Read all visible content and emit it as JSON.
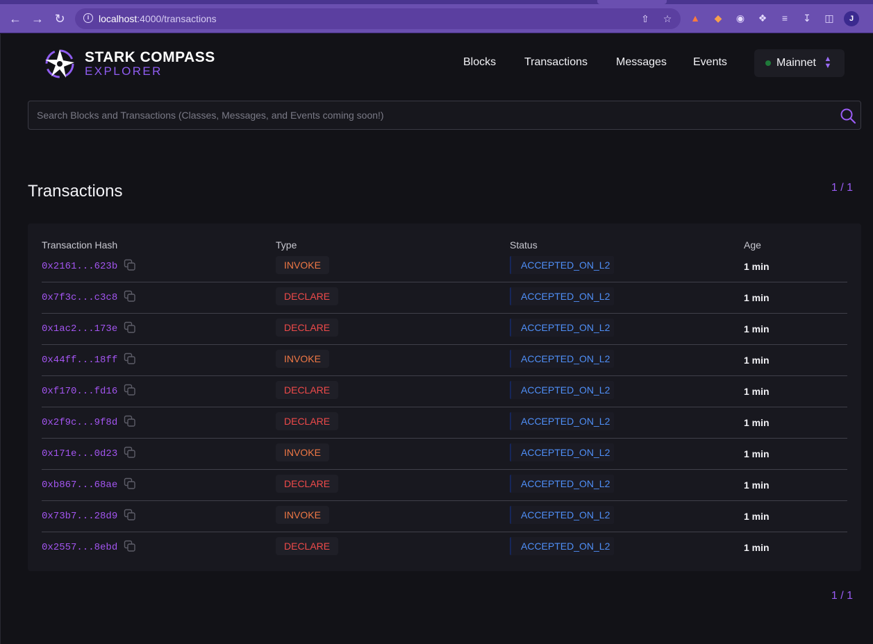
{
  "browser": {
    "url_host": "localhost",
    "url_path": ":4000/transactions",
    "profile_initial": "J"
  },
  "brand": {
    "line1": "STARK COMPASS",
    "line2": "EXPLORER",
    "accent": "#8f5cf0"
  },
  "nav": {
    "items": [
      "Blocks",
      "Transactions",
      "Messages",
      "Events"
    ],
    "network": "Mainnet"
  },
  "search": {
    "placeholder": "Search Blocks and Transactions  (Classes, Messages, and Events coming soon!)"
  },
  "page": {
    "title": "Transactions",
    "pager_top": "1 / 1",
    "pager_bottom": "1 / 1"
  },
  "table": {
    "headers": [
      "Transaction Hash",
      "Type",
      "Status",
      "Age"
    ],
    "rows": [
      {
        "hash": "0x2161...623b",
        "type": "INVOKE",
        "status": "ACCEPTED_ON_L2",
        "age": "1 min"
      },
      {
        "hash": "0x7f3c...c3c8",
        "type": "DECLARE",
        "status": "ACCEPTED_ON_L2",
        "age": "1 min"
      },
      {
        "hash": "0x1ac2...173e",
        "type": "DECLARE",
        "status": "ACCEPTED_ON_L2",
        "age": "1 min"
      },
      {
        "hash": "0x44ff...18ff",
        "type": "INVOKE",
        "status": "ACCEPTED_ON_L2",
        "age": "1 min"
      },
      {
        "hash": "0xf170...fd16",
        "type": "DECLARE",
        "status": "ACCEPTED_ON_L2",
        "age": "1 min"
      },
      {
        "hash": "0x2f9c...9f8d",
        "type": "DECLARE",
        "status": "ACCEPTED_ON_L2",
        "age": "1 min"
      },
      {
        "hash": "0x171e...0d23",
        "type": "INVOKE",
        "status": "ACCEPTED_ON_L2",
        "age": "1 min"
      },
      {
        "hash": "0xb867...68ae",
        "type": "DECLARE",
        "status": "ACCEPTED_ON_L2",
        "age": "1 min"
      },
      {
        "hash": "0x73b7...28d9",
        "type": "INVOKE",
        "status": "ACCEPTED_ON_L2",
        "age": "1 min"
      },
      {
        "hash": "0x2557...8ebd",
        "type": "DECLARE",
        "status": "ACCEPTED_ON_L2",
        "age": "1 min"
      }
    ]
  },
  "colors": {
    "invoke": "#f07845",
    "declare": "#ef4a4a",
    "status": "#4f8ff7",
    "hash": "#a355f0"
  }
}
